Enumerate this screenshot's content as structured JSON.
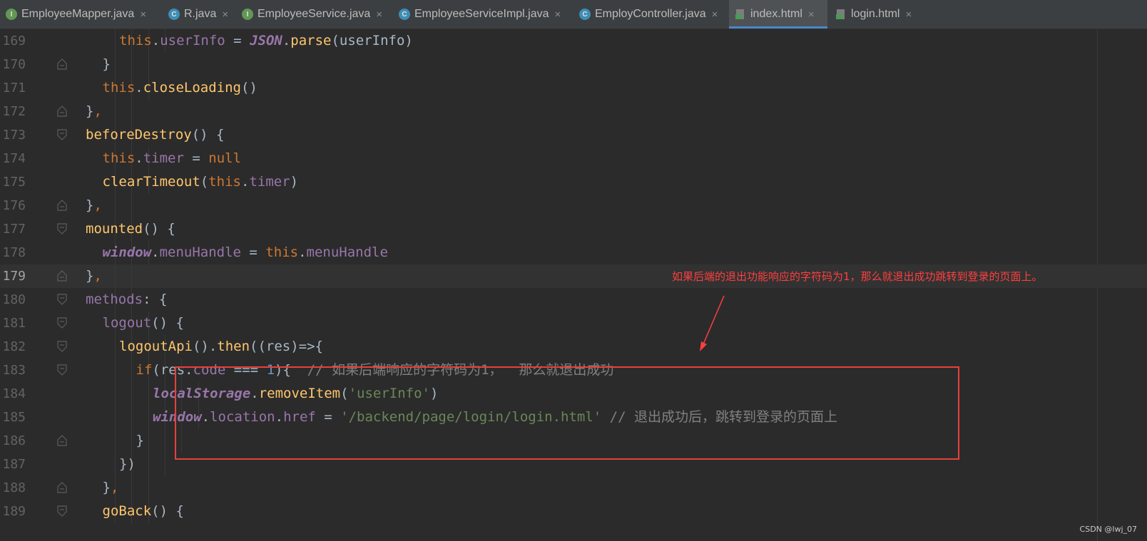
{
  "tabs": [
    {
      "label": "EmployeeMapper.java",
      "icon": "interface-icon"
    },
    {
      "label": "R.java",
      "icon": "class-icon"
    },
    {
      "label": "EmployeeService.java",
      "icon": "interface-icon"
    },
    {
      "label": "EmployeeServiceImpl.java",
      "icon": "class-icon"
    },
    {
      "label": "EmployController.java",
      "icon": "class-icon"
    },
    {
      "label": "index.html",
      "icon": "html-file-icon",
      "active": true
    },
    {
      "label": "login.html",
      "icon": "html-file-icon"
    }
  ],
  "close_glyph": "×",
  "icon_letters": {
    "interface": "I",
    "class": "C"
  },
  "editor": {
    "current_line": "179",
    "lines": [
      {
        "num": "169",
        "indent": 10,
        "tokens": [
          [
            "kw",
            "this"
          ],
          [
            "plain",
            "."
          ],
          [
            "prop",
            "userInfo"
          ],
          [
            "plain",
            " = "
          ],
          [
            "glob",
            "JSON"
          ],
          [
            "plain",
            "."
          ],
          [
            "fn",
            "parse"
          ],
          [
            "plain",
            "(userInfo)"
          ]
        ]
      },
      {
        "num": "170",
        "indent": 9,
        "tokens": [
          [
            "plain",
            "}"
          ]
        ]
      },
      {
        "num": "171",
        "indent": 9,
        "tokens": [
          [
            "kw",
            "this"
          ],
          [
            "plain",
            "."
          ],
          [
            "fn",
            "closeLoading"
          ],
          [
            "plain",
            "()"
          ]
        ]
      },
      {
        "num": "172",
        "indent": 8,
        "tokens": [
          [
            "plain",
            "}"
          ],
          [
            "kw",
            ","
          ]
        ]
      },
      {
        "num": "173",
        "indent": 8,
        "tokens": [
          [
            "fn",
            "beforeDestroy"
          ],
          [
            "plain",
            "() {"
          ]
        ]
      },
      {
        "num": "174",
        "indent": 9,
        "tokens": [
          [
            "kw",
            "this"
          ],
          [
            "plain",
            "."
          ],
          [
            "prop",
            "timer"
          ],
          [
            "plain",
            " = "
          ],
          [
            "kw",
            "null"
          ]
        ]
      },
      {
        "num": "175",
        "indent": 9,
        "tokens": [
          [
            "fn",
            "clearTimeout"
          ],
          [
            "plain",
            "("
          ],
          [
            "kw",
            "this"
          ],
          [
            "plain",
            "."
          ],
          [
            "prop",
            "timer"
          ],
          [
            "plain",
            ")"
          ]
        ]
      },
      {
        "num": "176",
        "indent": 8,
        "tokens": [
          [
            "plain",
            "}"
          ],
          [
            "kw",
            ","
          ]
        ]
      },
      {
        "num": "177",
        "indent": 8,
        "tokens": [
          [
            "fn",
            "mounted"
          ],
          [
            "plain",
            "() {"
          ]
        ]
      },
      {
        "num": "178",
        "indent": 9,
        "tokens": [
          [
            "glob",
            "window"
          ],
          [
            "plain",
            "."
          ],
          [
            "prop",
            "menuHandle"
          ],
          [
            "plain",
            " = "
          ],
          [
            "kw",
            "this"
          ],
          [
            "plain",
            "."
          ],
          [
            "prop",
            "menuHandle"
          ]
        ]
      },
      {
        "num": "179",
        "indent": 8,
        "tokens": [
          [
            "plain",
            "}"
          ],
          [
            "kw",
            ","
          ]
        ]
      },
      {
        "num": "180",
        "indent": 8,
        "tokens": [
          [
            "prop",
            "methods"
          ],
          [
            "plain",
            ": {"
          ]
        ]
      },
      {
        "num": "181",
        "indent": 9,
        "tokens": [
          [
            "prop",
            "logout"
          ],
          [
            "plain",
            "() {"
          ]
        ]
      },
      {
        "num": "182",
        "indent": 10,
        "tokens": [
          [
            "fn",
            "logoutApi"
          ],
          [
            "plain",
            "()."
          ],
          [
            "fn",
            "then"
          ],
          [
            "plain",
            "((res)=>{"
          ]
        ]
      },
      {
        "num": "183",
        "indent": 11,
        "tokens": [
          [
            "kw",
            "if"
          ],
          [
            "plain",
            "(res."
          ],
          [
            "prop",
            "code"
          ],
          [
            "plain",
            " === "
          ],
          [
            "num",
            "1"
          ],
          [
            "plain",
            "){  "
          ],
          [
            "cmt",
            "// 如果后端响应的字符码为1，  那么就退出成功"
          ]
        ]
      },
      {
        "num": "184",
        "indent": 12,
        "tokens": [
          [
            "glob",
            "localStorage"
          ],
          [
            "plain",
            "."
          ],
          [
            "fn",
            "removeItem"
          ],
          [
            "plain",
            "("
          ],
          [
            "str",
            "'userInfo'"
          ],
          [
            "plain",
            ")"
          ]
        ]
      },
      {
        "num": "185",
        "indent": 12,
        "tokens": [
          [
            "glob",
            "window"
          ],
          [
            "plain",
            "."
          ],
          [
            "prop",
            "location"
          ],
          [
            "plain",
            "."
          ],
          [
            "prop",
            "href"
          ],
          [
            "plain",
            " = "
          ],
          [
            "str",
            "'/backend/page/login/login.html'"
          ],
          [
            "plain",
            " "
          ],
          [
            "cmt",
            "// 退出成功后，跳转到登录的页面上"
          ]
        ]
      },
      {
        "num": "186",
        "indent": 11,
        "tokens": [
          [
            "plain",
            "}"
          ]
        ]
      },
      {
        "num": "187",
        "indent": 10,
        "tokens": [
          [
            "plain",
            "})"
          ]
        ]
      },
      {
        "num": "188",
        "indent": 9,
        "tokens": [
          [
            "plain",
            "}"
          ],
          [
            "kw",
            ","
          ]
        ]
      },
      {
        "num": "189",
        "indent": 9,
        "tokens": [
          [
            "fn",
            "goBack"
          ],
          [
            "plain",
            "() {"
          ]
        ]
      }
    ]
  },
  "annotation": {
    "text": "如果后端的退出功能响应的字符码为1，那么就退出成功跳转到登录的页面上。",
    "color": "#ff3f3f"
  },
  "watermark": "CSDN @lwj_07"
}
